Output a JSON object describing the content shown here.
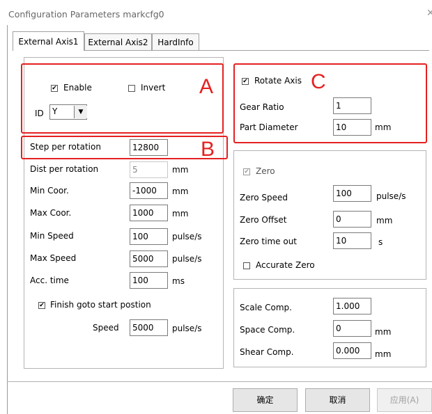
{
  "window": {
    "title": "Configuration Parameters markcfg0",
    "close_glyph": "✕"
  },
  "tabs": [
    {
      "label": "External Axis1",
      "active": true
    },
    {
      "label": "External Axis2",
      "active": false
    },
    {
      "label": "HardInfo",
      "active": false
    }
  ],
  "section_a": {
    "marker": "A",
    "enable": {
      "label": "Enable",
      "checked": true
    },
    "invert": {
      "label": "Invert",
      "checked": false
    },
    "id": {
      "label": "ID",
      "value": "Y"
    }
  },
  "section_b_marker": "B",
  "motion": {
    "step_per_rotation": {
      "label": "Step per rotation",
      "value": "12800"
    },
    "dist_per_rotation": {
      "label": "Dist per rotation",
      "value": "5",
      "unit": "mm"
    },
    "min_coor": {
      "label": "Min Coor.",
      "value": "-1000",
      "unit": "mm"
    },
    "max_coor": {
      "label": "Max Coor.",
      "value": "1000",
      "unit": "mm"
    },
    "min_speed": {
      "label": "Min Speed",
      "value": "100",
      "unit": "pulse/s"
    },
    "max_speed": {
      "label": "Max Speed",
      "value": "5000",
      "unit": "pulse/s"
    },
    "acc_time": {
      "label": "Acc. time",
      "value": "100",
      "unit": "ms"
    },
    "finish_goto": {
      "label": "Finish goto start postion",
      "checked": true
    },
    "speed": {
      "label": "Speed",
      "value": "5000",
      "unit": "pulse/s"
    }
  },
  "section_c": {
    "marker": "C",
    "rotate_axis": {
      "label": "Rotate Axis",
      "checked": true
    },
    "gear_ratio": {
      "label": "Gear Ratio",
      "value": "1"
    },
    "part_diameter": {
      "label": "Part Diameter",
      "value": "10",
      "unit": "mm"
    }
  },
  "zero": {
    "zero_check": {
      "label": "Zero",
      "checked": true
    },
    "zero_speed": {
      "label": "Zero Speed",
      "value": "100",
      "unit": "pulse/s"
    },
    "zero_offset": {
      "label": "Zero Offset",
      "value": "0",
      "unit": "mm"
    },
    "zero_timeout": {
      "label": "Zero time out",
      "value": "10",
      "unit": "s"
    },
    "accurate_zero": {
      "label": "Accurate Zero",
      "checked": false
    }
  },
  "comp": {
    "scale": {
      "label": "Scale Comp.",
      "value": "1.000"
    },
    "space": {
      "label": "Space Comp.",
      "value": "0",
      "unit": "mm"
    },
    "shear": {
      "label": "Shear Comp.",
      "value": "0.000",
      "unit": "mm"
    }
  },
  "buttons": {
    "ok": "确定",
    "cancel": "取消",
    "apply": "应用(A)"
  },
  "colors": {
    "highlight": "#e52020",
    "check": "✔",
    "dropdown": "▼"
  }
}
